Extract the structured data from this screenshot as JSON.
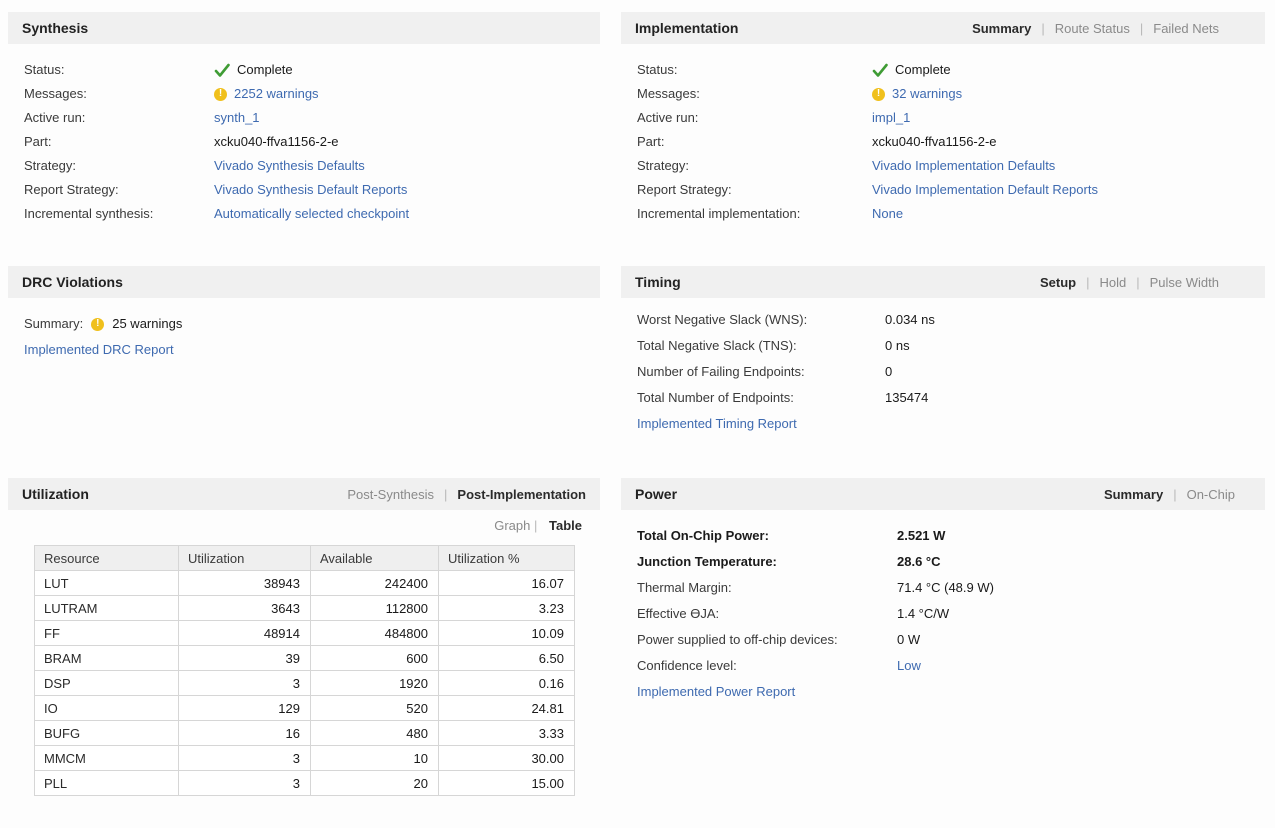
{
  "colors": {
    "link": "#3e6ab0",
    "warning": "#f0c01c",
    "success": "#3f9c35",
    "header_bg": "#f0f0f0"
  },
  "ui": {
    "tab_separator": "|"
  },
  "synthesis": {
    "title": "Synthesis",
    "rows": {
      "status": {
        "label": "Status:",
        "value": "Complete"
      },
      "messages": {
        "label": "Messages:",
        "value": "2252 warnings"
      },
      "active_run": {
        "label": "Active run:",
        "value": "synth_1"
      },
      "part": {
        "label": "Part:",
        "value": "xcku040-ffva1156-2-e"
      },
      "strategy": {
        "label": "Strategy:",
        "value": "Vivado Synthesis Defaults"
      },
      "report_strategy": {
        "label": "Report Strategy:",
        "value": "Vivado Synthesis Default Reports"
      },
      "incremental": {
        "label": "Incremental synthesis:",
        "value": "Automatically selected checkpoint"
      }
    }
  },
  "implementation": {
    "title": "Implementation",
    "tabs": {
      "summary": "Summary",
      "route_status": "Route Status",
      "failed_nets": "Failed Nets"
    },
    "rows": {
      "status": {
        "label": "Status:",
        "value": "Complete"
      },
      "messages": {
        "label": "Messages:",
        "value": "32 warnings"
      },
      "active_run": {
        "label": "Active run:",
        "value": "impl_1"
      },
      "part": {
        "label": "Part:",
        "value": "xcku040-ffva1156-2-e"
      },
      "strategy": {
        "label": "Strategy:",
        "value": "Vivado Implementation Defaults"
      },
      "report_strategy": {
        "label": "Report Strategy:",
        "value": "Vivado Implementation Default Reports"
      },
      "incremental": {
        "label": "Incremental implementation:",
        "value": "None"
      }
    }
  },
  "drc": {
    "title": "DRC Violations",
    "summary_label": "Summary:",
    "summary_value": "25 warnings",
    "report_link": "Implemented DRC Report"
  },
  "timing": {
    "title": "Timing",
    "tabs": {
      "setup": "Setup",
      "hold": "Hold",
      "pulse_width": "Pulse Width"
    },
    "rows": {
      "wns": {
        "label": "Worst Negative Slack (WNS):",
        "value": "0.034 ns"
      },
      "tns": {
        "label": "Total Negative Slack (TNS):",
        "value": "0 ns"
      },
      "failing_endpoints": {
        "label": "Number of Failing Endpoints:",
        "value": "0"
      },
      "total_endpoints": {
        "label": "Total Number of Endpoints:",
        "value": "135474"
      }
    },
    "report_link": "Implemented Timing Report"
  },
  "utilization": {
    "title": "Utilization",
    "tabs": {
      "post_synthesis": "Post-Synthesis",
      "post_implementation": "Post-Implementation"
    },
    "views": {
      "graph": "Graph",
      "table": "Table"
    },
    "table": {
      "headers": [
        "Resource",
        "Utilization",
        "Available",
        "Utilization %"
      ],
      "rows": [
        [
          "LUT",
          "38943",
          "242400",
          "16.07"
        ],
        [
          "LUTRAM",
          "3643",
          "112800",
          "3.23"
        ],
        [
          "FF",
          "48914",
          "484800",
          "10.09"
        ],
        [
          "BRAM",
          "39",
          "600",
          "6.50"
        ],
        [
          "DSP",
          "3",
          "1920",
          "0.16"
        ],
        [
          "IO",
          "129",
          "520",
          "24.81"
        ],
        [
          "BUFG",
          "16",
          "480",
          "3.33"
        ],
        [
          "MMCM",
          "3",
          "10",
          "30.00"
        ],
        [
          "PLL",
          "3",
          "20",
          "15.00"
        ]
      ]
    }
  },
  "power": {
    "title": "Power",
    "tabs": {
      "summary": "Summary",
      "on_chip": "On-Chip"
    },
    "rows": {
      "total_power": {
        "label": "Total On-Chip Power:",
        "value": "2.521 W"
      },
      "junction_temp": {
        "label": "Junction Temperature:",
        "value": "28.6 °C"
      },
      "thermal_margin": {
        "label": "Thermal Margin:",
        "value": "71.4 °C (48.9 W)"
      },
      "effective_theta": {
        "label": "Effective ϴJA:",
        "value": "1.4 °C/W"
      },
      "off_chip": {
        "label": "Power supplied to off-chip devices:",
        "value": "0 W"
      },
      "confidence": {
        "label": "Confidence level:",
        "value": "Low"
      }
    },
    "report_link": "Implemented Power Report"
  }
}
